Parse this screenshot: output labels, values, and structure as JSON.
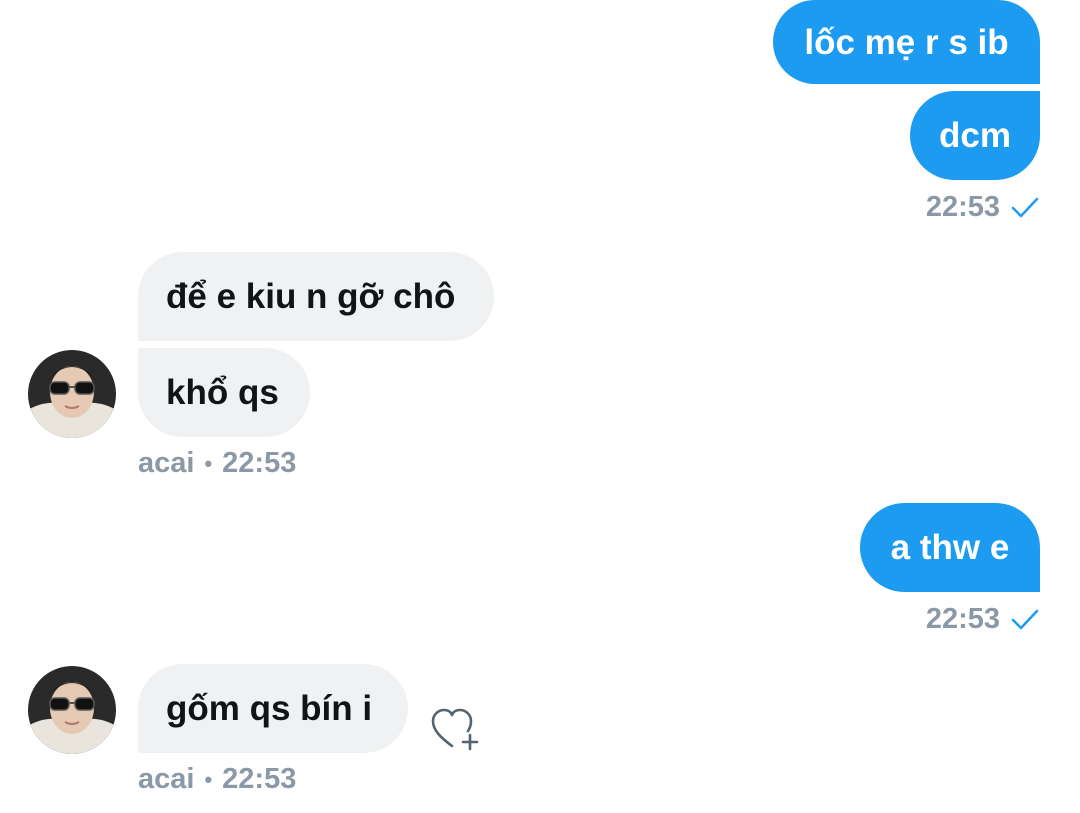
{
  "colors": {
    "outgoing_bubble": "#1d9bf0",
    "incoming_bubble": "#eff1f3",
    "meta_text": "#8b98a5",
    "read_check": "#1d9bf0"
  },
  "messages": [
    {
      "direction": "outgoing",
      "text": "lốc mẹ r s ib"
    },
    {
      "direction": "outgoing",
      "text": "dcm"
    },
    {
      "direction": "incoming",
      "text": "để e kiu n gỡ chô"
    },
    {
      "direction": "incoming",
      "text": "khổ qs"
    },
    {
      "direction": "outgoing",
      "text": "a thw e"
    },
    {
      "direction": "incoming",
      "text": "gốm qs bín i"
    }
  ],
  "meta": {
    "group1_time": "22:53",
    "group2_sender": "acai",
    "group2_time": "22:53",
    "group3_time": "22:53",
    "group4_sender": "acai",
    "group4_time": "22:53",
    "separator": "•"
  },
  "icons": {
    "read_receipt": "check-icon",
    "react": "heart-plus-icon",
    "avatar": "avatar-photo"
  }
}
